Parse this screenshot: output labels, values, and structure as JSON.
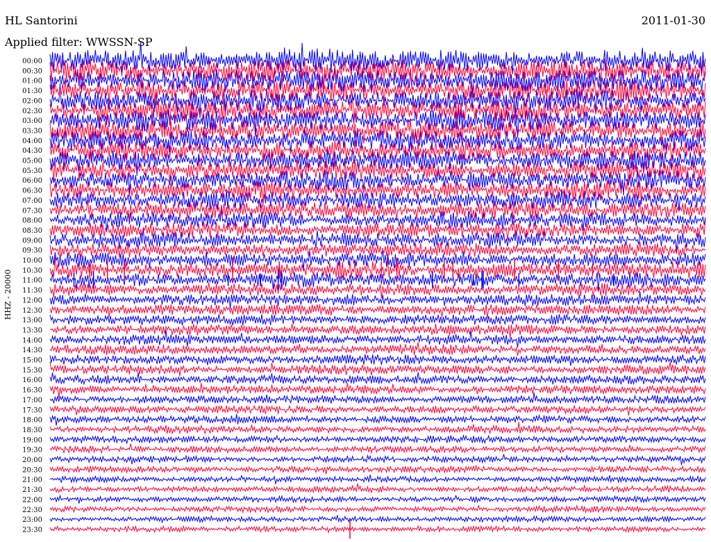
{
  "header": {
    "title": "HL Santorini",
    "date": "2011-01-30",
    "filter": "Applied filter: WWSSN-SP"
  },
  "chart_data": {
    "type": "line",
    "subtype": "helicorder",
    "title": "HL Santorini",
    "date": "2011-01-30",
    "filter": "Applied filter: WWSSN-SP",
    "ylabel": "HHZ - 20000",
    "xlabel": "",
    "row_labels": [
      "00:00",
      "00:30",
      "01:00",
      "01:30",
      "02:00",
      "02:30",
      "03:00",
      "03:30",
      "04:00",
      "04:30",
      "05:00",
      "05:30",
      "06:00",
      "06:30",
      "07:00",
      "07:30",
      "08:00",
      "08:30",
      "09:00",
      "09:30",
      "10:00",
      "10:30",
      "11:00",
      "11:30",
      "12:00",
      "12:30",
      "13:00",
      "13:30",
      "14:00",
      "14:30",
      "15:00",
      "15:30",
      "16:00",
      "16:30",
      "17:00",
      "17:30",
      "18:00",
      "18:30",
      "19:00",
      "19:30",
      "20:00",
      "20:30",
      "21:00",
      "21:30",
      "22:00",
      "22:30",
      "23:00",
      "23:30"
    ],
    "series_colors": [
      "#0000ff",
      "#ff0033"
    ],
    "row_amplitude_relative": [
      1.0,
      1.0,
      1.0,
      0.98,
      0.96,
      0.95,
      0.94,
      0.92,
      0.9,
      0.88,
      0.86,
      0.84,
      0.82,
      0.8,
      0.78,
      0.74,
      0.7,
      0.66,
      0.64,
      0.62,
      0.62,
      0.7,
      0.62,
      0.55,
      0.5,
      0.48,
      0.46,
      0.45,
      0.44,
      0.43,
      0.42,
      0.41,
      0.4,
      0.38,
      0.36,
      0.35,
      0.34,
      0.33,
      0.31,
      0.3,
      0.29,
      0.28,
      0.27,
      0.27,
      0.26,
      0.26,
      0.25,
      0.25
    ],
    "events": [
      {
        "row": "10:30",
        "description": "spiky transients"
      },
      {
        "row": "11:00",
        "description": "spiky transients"
      },
      {
        "row": "23:30",
        "description": "single large spike"
      }
    ],
    "grid": false,
    "legend": "none"
  },
  "colors": {
    "blue_trace": "#0000ff",
    "red_trace": "#ff0033",
    "background": "#ffffff",
    "text": "#000000"
  }
}
